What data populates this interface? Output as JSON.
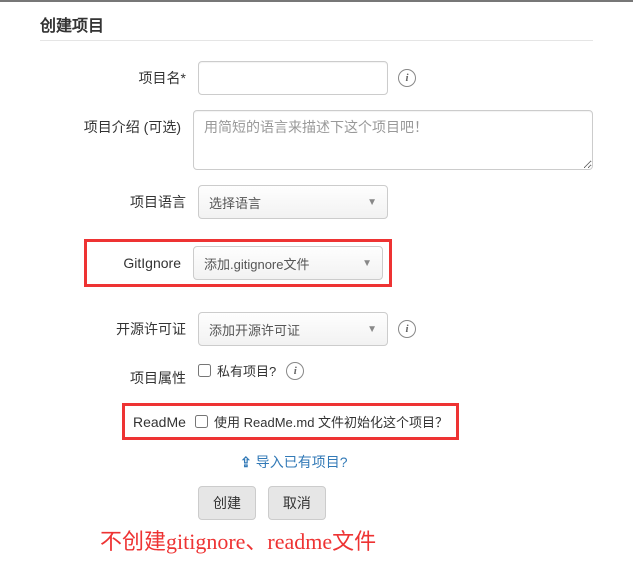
{
  "header": {
    "title": "创建项目"
  },
  "form": {
    "name": {
      "label": "项目名*",
      "value": ""
    },
    "desc": {
      "label": "项目介绍 (可选)",
      "placeholder": "用简短的语言来描述下这个项目吧！",
      "value": ""
    },
    "lang": {
      "label": "项目语言",
      "selected": "选择语言"
    },
    "gitignore": {
      "label": "GitIgnore",
      "selected": "添加.gitignore文件"
    },
    "license": {
      "label": "开源许可证",
      "selected": "添加开源许可证"
    },
    "visibility": {
      "label": "项目属性",
      "checkbox_label": "私有项目?"
    },
    "readme": {
      "label": "ReadMe",
      "checkbox_label": "使用 ReadMe.md 文件初始化这个项目？"
    },
    "import": {
      "icon": "⇪",
      "label": "导入已有项目?"
    },
    "buttons": {
      "submit": "创建",
      "cancel": "取消"
    }
  },
  "annotation": "不创建gitignore、readme文件"
}
